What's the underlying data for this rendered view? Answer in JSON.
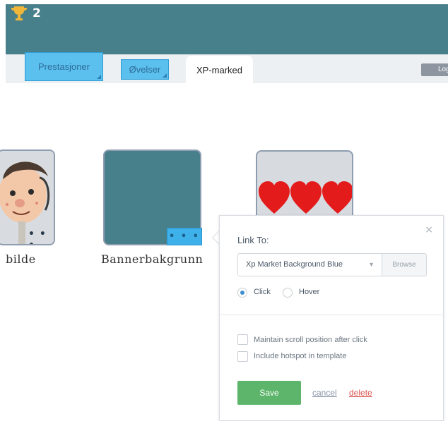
{
  "header": {
    "trophy_count": "2",
    "trophy_icon": "trophy-icon",
    "background": "#477f8a"
  },
  "tabs": [
    {
      "label": "Prestasjoner",
      "hotspot": true
    },
    {
      "label": "Øvelser",
      "hotspot": true
    },
    {
      "label": "XP-marked",
      "active": true
    }
  ],
  "logout_label": "Log",
  "cards": [
    {
      "caption": "bilde",
      "dots": "• • •"
    },
    {
      "caption": "Bannerbakgrunn",
      "dots": "• • •"
    },
    {
      "caption": "",
      "hearts": 3
    }
  ],
  "popup": {
    "link_to_label": "Link To:",
    "select_value": "Xp Market Background Blue",
    "browse_label": "Browse",
    "trigger_options": [
      {
        "label": "Click",
        "checked": true
      },
      {
        "label": "Hover",
        "checked": false
      }
    ],
    "options": [
      {
        "label": "Maintain scroll position after click",
        "checked": false
      },
      {
        "label": "Include hotspot in template",
        "checked": false
      }
    ],
    "save_label": "Save",
    "cancel_label": "cancel",
    "delete_label": "delete",
    "close_icon": "×"
  },
  "colors": {
    "accent_teal": "#477f8a",
    "hotspot_blue": "#5bc0ee",
    "save_green": "#5cb56a",
    "delete_red": "#d9534f",
    "heart_red": "#e31b1b"
  }
}
